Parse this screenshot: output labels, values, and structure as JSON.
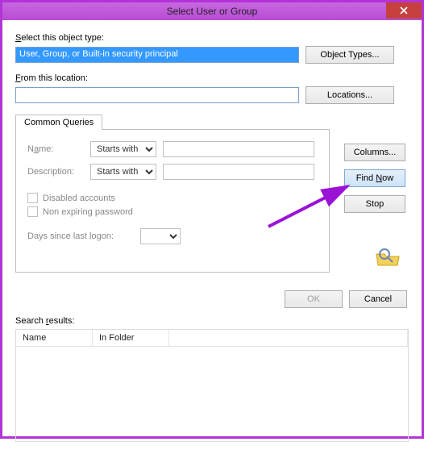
{
  "window": {
    "title": "Select User or Group"
  },
  "object_type": {
    "label_pre": "S",
    "label_post": "elect this object type:",
    "value": "User, Group, or Built-in security principal",
    "button": "Object Types..."
  },
  "location": {
    "label_pre": "F",
    "label_post": "rom this location:",
    "value": "",
    "button": "Locations..."
  },
  "tab": {
    "label": "Common Queries"
  },
  "queries": {
    "name_label": "Name:",
    "name_mode": "Starts with",
    "name_value": "",
    "desc_label": "Description:",
    "desc_mode": "Starts with",
    "desc_value": "",
    "disabled_chk": "Disabled accounts",
    "nonexpiring_chk": "Non expiring password",
    "days_label": "Days since last logon:"
  },
  "rightcol": {
    "columns": "Columns...",
    "find_pre": "Find ",
    "find_hot": "N",
    "find_post": "ow",
    "stop": "Stop"
  },
  "bottom": {
    "ok": "OK",
    "cancel": "Cancel"
  },
  "results": {
    "label_pre": "Search ",
    "label_hot": "r",
    "label_post": "esults:",
    "col1": "Name",
    "col2": "In Folder"
  }
}
